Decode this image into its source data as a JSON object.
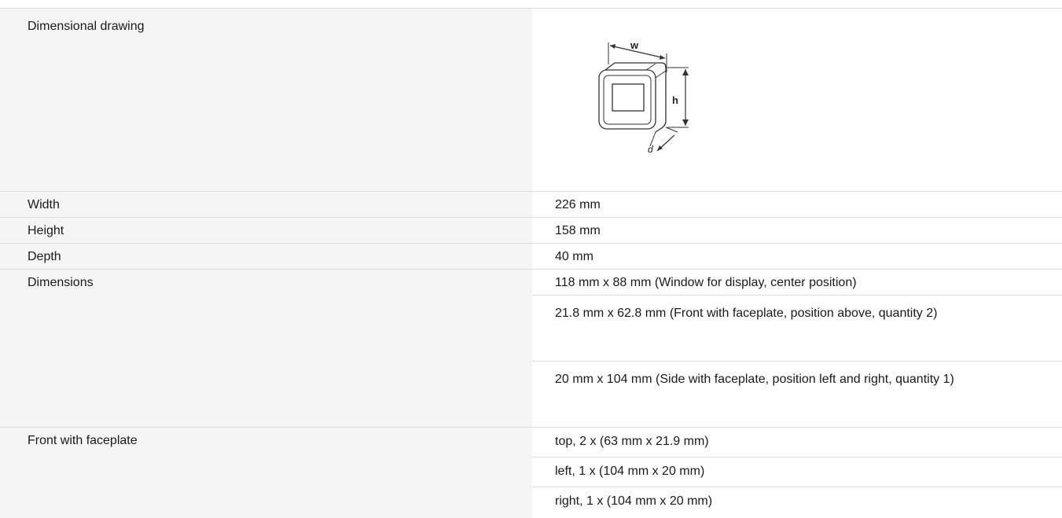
{
  "rows": {
    "drawing": {
      "label": "Dimensional drawing"
    },
    "width": {
      "label": "Width",
      "value": "226 mm"
    },
    "height": {
      "label": "Height",
      "value": "158 mm"
    },
    "depth": {
      "label": "Depth",
      "value": "40 mm"
    },
    "dimensions": {
      "label": "Dimensions",
      "values": [
        "118 mm x 88 mm (Window for display, center position)",
        "21.8 mm x 62.8 mm (Front with faceplate, position above, quantity 2)",
        "20 mm x 104 mm (Side with faceplate, position left and right, quantity 1)"
      ]
    },
    "front_faceplate": {
      "label": "Front with faceplate",
      "values": [
        "top, 2 x (63 mm x 21.9 mm)",
        "left, 1 x (104 mm x 20 mm)",
        "right, 1 x (104 mm x 20 mm)"
      ]
    }
  },
  "drawing_labels": {
    "w": "w",
    "h": "h",
    "d": "d"
  }
}
